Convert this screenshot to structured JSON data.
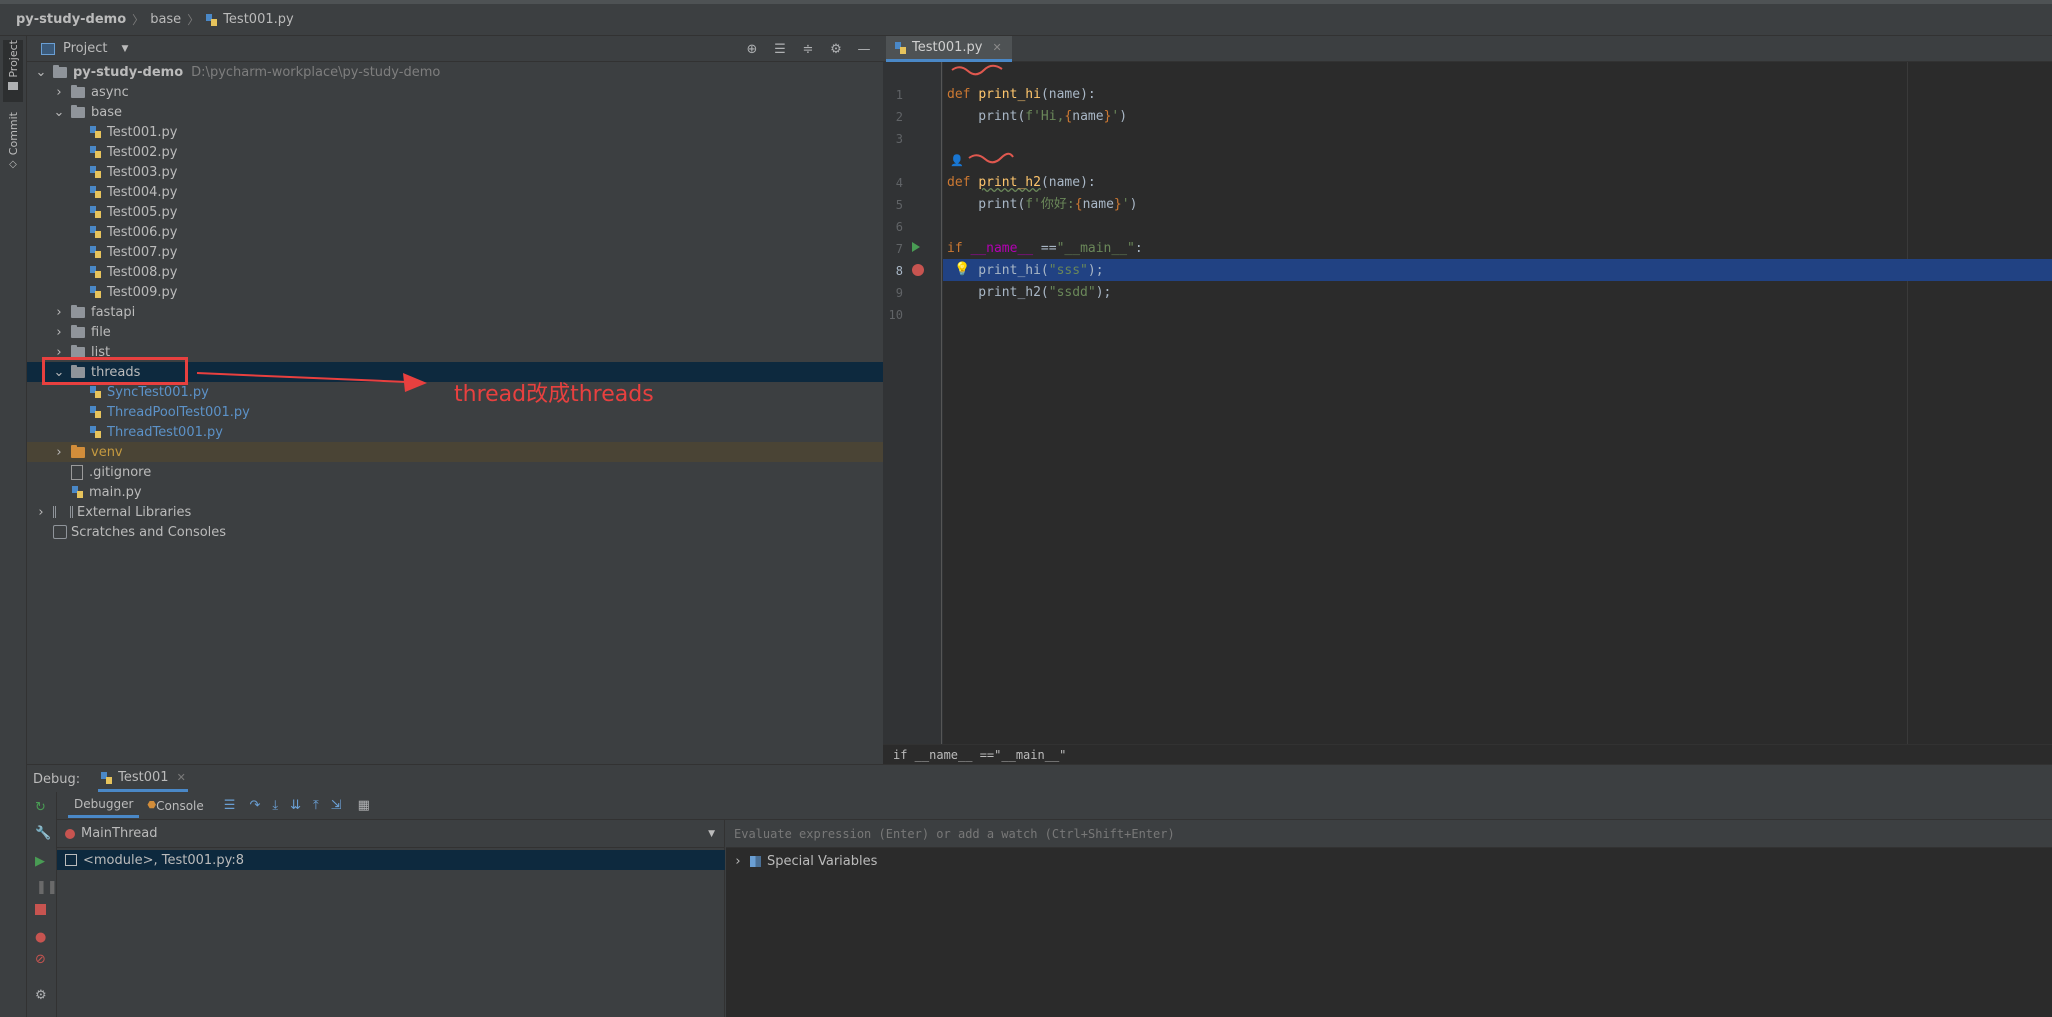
{
  "breadcrumb": {
    "project": "py-study-demo",
    "folder": "base",
    "file": "Test001.py"
  },
  "left_stripe": {
    "project_tab": "Project",
    "commit_tab": "Commit"
  },
  "project_panel": {
    "header_title": "Project",
    "tree": {
      "root": {
        "name": "py-study-demo",
        "path": "D:\\pycharm-workplace\\py-study-demo"
      },
      "async": "async",
      "base": "base",
      "base_files": [
        "Test001.py",
        "Test002.py",
        "Test003.py",
        "Test004.py",
        "Test005.py",
        "Test006.py",
        "Test007.py",
        "Test008.py",
        "Test009.py"
      ],
      "fastapi": "fastapi",
      "file": "file",
      "list": "list",
      "threads": "threads",
      "threads_files": [
        "SyncTest001.py",
        "ThreadPoolTest001.py",
        "ThreadTest001.py"
      ],
      "venv": "venv",
      "gitignore": ".gitignore",
      "main": "main.py",
      "external_libraries": "External Libraries",
      "scratches": "Scratches and Consoles"
    }
  },
  "annotation": {
    "text": "thread改成threads",
    "color": "#e8403f"
  },
  "editor": {
    "tab": "Test001.py",
    "line_numbers": [
      "1",
      "2",
      "3",
      "4",
      "5",
      "6",
      "7",
      "8",
      "9",
      "10"
    ],
    "code": {
      "l1_kw": "def ",
      "l1_fn": "print_hi",
      "l1_rest": "(name):",
      "l2_a": "    print(",
      "l2_f": "f'Hi,",
      "l2_b1": "{",
      "l2_v": "name",
      "l2_b2": "}",
      "l2_e": "'",
      "l2_c": ")",
      "l4_kw": "def ",
      "l4_fn": "print_h2",
      "l4_rest": "(name):",
      "l5_a": "    print(",
      "l5_f": "f'你好:",
      "l5_b1": "{",
      "l5_v": "name",
      "l5_b2": "}",
      "l5_e": "'",
      "l5_c": ")",
      "l7_kw": "if ",
      "l7_d": "__name__",
      "l7_eq": " ==",
      "l7_s": "\"__main__\"",
      "l7_c": ":",
      "l8_a": "    print_hi(",
      "l8_s": "\"sss\"",
      "l8_c": ");",
      "l9_a": "    print_h2(",
      "l9_s": "\"ssdd\"",
      "l9_c": ");"
    },
    "status_text": "if __name__ ==\"__main__\""
  },
  "debug": {
    "label": "Debug:",
    "session": "Test001",
    "tab_debugger": "Debugger",
    "tab_console": "Console",
    "thread": "MainThread",
    "frame": "<module>, Test001.py:8",
    "eval_placeholder": "Evaluate expression (Enter) or add a watch (Ctrl+Shift+Enter)",
    "special_variables": "Special Variables"
  },
  "colors": {
    "selection": "#214283",
    "breakpoint": "#c75450",
    "accent": "#4a88c7"
  }
}
